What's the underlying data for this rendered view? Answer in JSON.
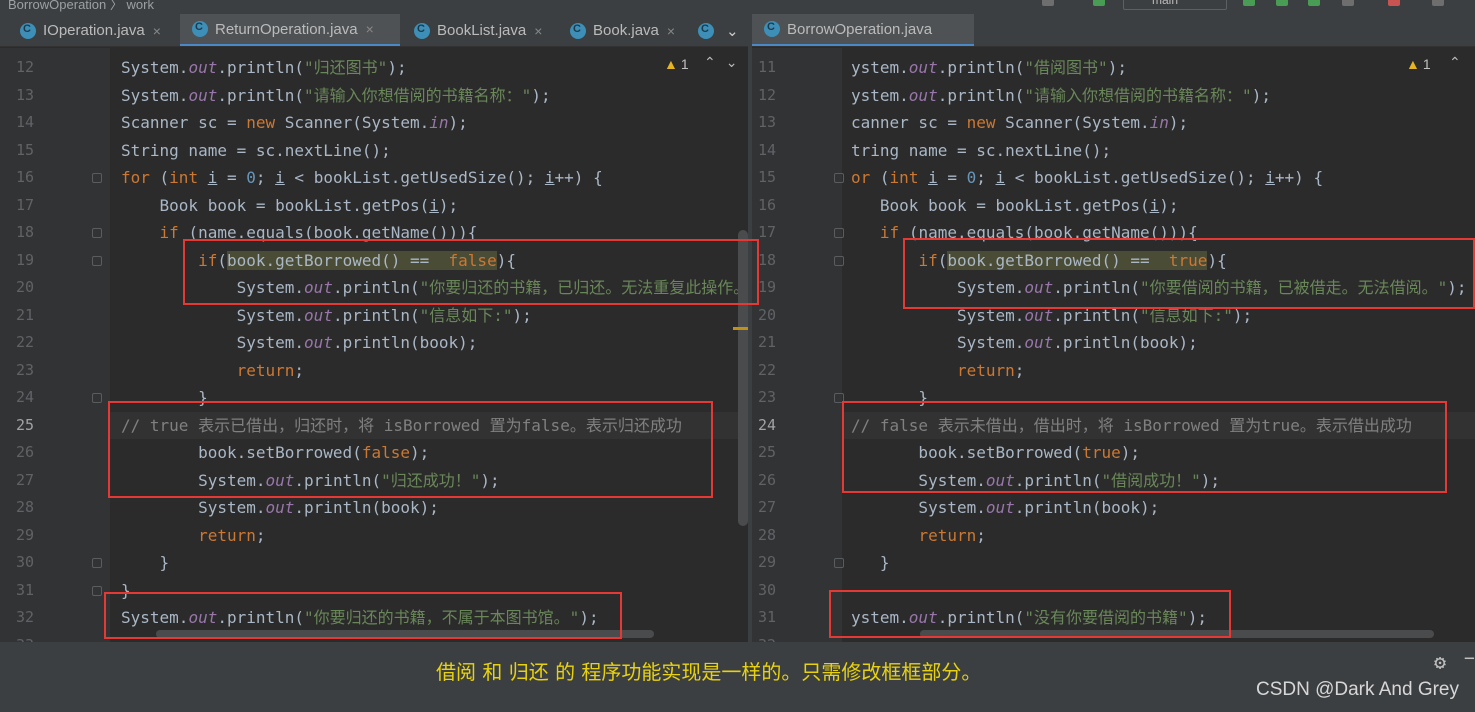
{
  "topbar": {
    "breadcrumb": "BorrowOperation  〉 work",
    "branch": "main"
  },
  "left_tabs": [
    {
      "label": "IOperation.java",
      "active": false
    },
    {
      "label": "ReturnOperation.java",
      "active": true
    },
    {
      "label": "BookList.java",
      "active": false
    },
    {
      "label": "Book.java",
      "active": false
    }
  ],
  "right_tabs": [
    {
      "label": "BorrowOperation.java",
      "active": true
    }
  ],
  "left_editor": {
    "warning_count": "1",
    "lines": [
      {
        "n": "12",
        "tokens": [
          [
            "p",
            "System."
          ],
          [
            "fld",
            "out"
          ],
          [
            "p",
            ".println("
          ],
          [
            "str",
            "\"归还图书\""
          ],
          [
            "p",
            ");"
          ]
        ]
      },
      {
        "n": "13",
        "tokens": [
          [
            "p",
            "System."
          ],
          [
            "fld",
            "out"
          ],
          [
            "p",
            ".println("
          ],
          [
            "str",
            "\"请输入你想借阅的书籍名称：\""
          ],
          [
            "p",
            ");"
          ]
        ]
      },
      {
        "n": "14",
        "tokens": [
          [
            "p",
            "Scanner sc = "
          ],
          [
            "kw",
            "new "
          ],
          [
            "p",
            "Scanner(System."
          ],
          [
            "fld",
            "in"
          ],
          [
            "p",
            ");"
          ]
        ]
      },
      {
        "n": "15",
        "tokens": [
          [
            "p",
            "String name = sc.nextLine();"
          ]
        ]
      },
      {
        "n": "16",
        "tokens": [
          [
            "kw",
            "for "
          ],
          [
            "p",
            "("
          ],
          [
            "kw",
            "int "
          ],
          [
            "u",
            "i"
          ],
          [
            "p",
            " = "
          ],
          [
            "num",
            "0"
          ],
          [
            "p",
            "; "
          ],
          [
            "u",
            "i"
          ],
          [
            "p",
            " < bookList.getUsedSize(); "
          ],
          [
            "u",
            "i"
          ],
          [
            "p",
            "++) {"
          ]
        ]
      },
      {
        "n": "17",
        "tokens": [
          [
            "p",
            "    Book book = bookList.getPos("
          ],
          [
            "u",
            "i"
          ],
          [
            "p",
            ");"
          ]
        ]
      },
      {
        "n": "18",
        "tokens": [
          [
            "p",
            "    "
          ],
          [
            "kw",
            "if "
          ],
          [
            "p",
            "(name.equals(book.getName())){"
          ]
        ]
      },
      {
        "n": "19",
        "tokens": [
          [
            "p",
            "        "
          ],
          [
            "kw",
            "if"
          ],
          [
            "p",
            "("
          ],
          [
            "hl",
            "book.getBorrowed() ==  "
          ],
          [
            "hlkw",
            "false"
          ],
          [
            "p",
            "){"
          ]
        ]
      },
      {
        "n": "20",
        "tokens": [
          [
            "p",
            "            System."
          ],
          [
            "fld",
            "out"
          ],
          [
            "p",
            ".println("
          ],
          [
            "str",
            "\"你要归还的书籍，已归还。无法重复此操作。\""
          ],
          [
            "p",
            ");"
          ]
        ]
      },
      {
        "n": "21",
        "tokens": [
          [
            "p",
            "            System."
          ],
          [
            "fld",
            "out"
          ],
          [
            "p",
            ".println("
          ],
          [
            "str",
            "\"信息如下:\""
          ],
          [
            "p",
            ");"
          ]
        ]
      },
      {
        "n": "22",
        "tokens": [
          [
            "p",
            "            System."
          ],
          [
            "fld",
            "out"
          ],
          [
            "p",
            ".println(book);"
          ]
        ]
      },
      {
        "n": "23",
        "tokens": [
          [
            "p",
            "            "
          ],
          [
            "kw",
            "return"
          ],
          [
            "p",
            ";"
          ]
        ]
      },
      {
        "n": "24",
        "tokens": [
          [
            "p",
            "        }"
          ]
        ]
      },
      {
        "n": "25",
        "tokens": [
          [
            "cmt",
            "// true 表示已借出，归还时，将 isBorrowed 置为false。表示归还成功"
          ]
        ]
      },
      {
        "n": "26",
        "tokens": [
          [
            "p",
            "        book.setBorrowed("
          ],
          [
            "kw",
            "false"
          ],
          [
            "p",
            ");"
          ]
        ]
      },
      {
        "n": "27",
        "tokens": [
          [
            "p",
            "        System."
          ],
          [
            "fld",
            "out"
          ],
          [
            "p",
            ".println("
          ],
          [
            "str",
            "\"归还成功！\""
          ],
          [
            "p",
            ");"
          ]
        ]
      },
      {
        "n": "28",
        "tokens": [
          [
            "p",
            "        System."
          ],
          [
            "fld",
            "out"
          ],
          [
            "p",
            ".println(book);"
          ]
        ]
      },
      {
        "n": "29",
        "tokens": [
          [
            "p",
            "        "
          ],
          [
            "kw",
            "return"
          ],
          [
            "p",
            ";"
          ]
        ]
      },
      {
        "n": "30",
        "tokens": [
          [
            "p",
            "    }"
          ]
        ]
      },
      {
        "n": "31",
        "tokens": [
          [
            "p",
            "}"
          ]
        ]
      },
      {
        "n": "32",
        "tokens": [
          [
            "p",
            "System."
          ],
          [
            "fld",
            "out"
          ],
          [
            "p",
            ".println("
          ],
          [
            "str",
            "\"你要归还的书籍，不属于本图书馆。\""
          ],
          [
            "p",
            ");"
          ]
        ]
      },
      {
        "n": "33",
        "tokens": []
      }
    ]
  },
  "right_editor": {
    "warning_count": "1",
    "lines": [
      {
        "n": "11",
        "tokens": [
          [
            "p",
            "ystem."
          ],
          [
            "fld",
            "out"
          ],
          [
            "p",
            ".println("
          ],
          [
            "str",
            "\"借阅图书\""
          ],
          [
            "p",
            ");"
          ]
        ]
      },
      {
        "n": "12",
        "tokens": [
          [
            "p",
            "ystem."
          ],
          [
            "fld",
            "out"
          ],
          [
            "p",
            ".println("
          ],
          [
            "str",
            "\"请输入你想借阅的书籍名称：\""
          ],
          [
            "p",
            ");"
          ]
        ]
      },
      {
        "n": "13",
        "tokens": [
          [
            "p",
            "canner sc = "
          ],
          [
            "kw",
            "new "
          ],
          [
            "p",
            "Scanner(System."
          ],
          [
            "fld",
            "in"
          ],
          [
            "p",
            ");"
          ]
        ]
      },
      {
        "n": "14",
        "tokens": [
          [
            "p",
            "tring name = sc.nextLine();"
          ]
        ]
      },
      {
        "n": "15",
        "tokens": [
          [
            "kw",
            "or "
          ],
          [
            "p",
            "("
          ],
          [
            "kw",
            "int "
          ],
          [
            "u",
            "i"
          ],
          [
            "p",
            " = "
          ],
          [
            "num",
            "0"
          ],
          [
            "p",
            "; "
          ],
          [
            "u",
            "i"
          ],
          [
            "p",
            " < bookList.getUsedSize(); "
          ],
          [
            "u",
            "i"
          ],
          [
            "p",
            "++) {"
          ]
        ]
      },
      {
        "n": "16",
        "tokens": [
          [
            "p",
            "   Book book = bookList.getPos("
          ],
          [
            "u",
            "i"
          ],
          [
            "p",
            ");"
          ]
        ]
      },
      {
        "n": "17",
        "tokens": [
          [
            "p",
            "   "
          ],
          [
            "kw",
            "if "
          ],
          [
            "p",
            "(name.equals(book.getName())){"
          ]
        ]
      },
      {
        "n": "18",
        "tokens": [
          [
            "p",
            "       "
          ],
          [
            "kw",
            "if"
          ],
          [
            "p",
            "("
          ],
          [
            "hl",
            "book.getBorrowed() ==  "
          ],
          [
            "hlkw",
            "true"
          ],
          [
            "p",
            "){"
          ]
        ]
      },
      {
        "n": "19",
        "tokens": [
          [
            "p",
            "           System."
          ],
          [
            "fld",
            "out"
          ],
          [
            "p",
            ".println("
          ],
          [
            "str",
            "\"你要借阅的书籍，已被借走。无法借阅。\""
          ],
          [
            "p",
            ");"
          ]
        ]
      },
      {
        "n": "20",
        "tokens": [
          [
            "p",
            "           System."
          ],
          [
            "fld",
            "out"
          ],
          [
            "p",
            ".println("
          ],
          [
            "str",
            "\"信息如下:\""
          ],
          [
            "p",
            ");"
          ]
        ]
      },
      {
        "n": "21",
        "tokens": [
          [
            "p",
            "           System."
          ],
          [
            "fld",
            "out"
          ],
          [
            "p",
            ".println(book);"
          ]
        ]
      },
      {
        "n": "22",
        "tokens": [
          [
            "p",
            "           "
          ],
          [
            "kw",
            "return"
          ],
          [
            "p",
            ";"
          ]
        ]
      },
      {
        "n": "23",
        "tokens": [
          [
            "p",
            "       }"
          ]
        ]
      },
      {
        "n": "24",
        "tokens": [
          [
            "cmt",
            "// false 表示未借出，借出时，将 isBorrowed 置为true。表示借出成功"
          ]
        ]
      },
      {
        "n": "25",
        "tokens": [
          [
            "p",
            "       book.setBorrowed("
          ],
          [
            "kw",
            "true"
          ],
          [
            "p",
            ");"
          ]
        ]
      },
      {
        "n": "26",
        "tokens": [
          [
            "p",
            "       System."
          ],
          [
            "fld",
            "out"
          ],
          [
            "p",
            ".println("
          ],
          [
            "str",
            "\"借阅成功！\""
          ],
          [
            "p",
            ");"
          ]
        ]
      },
      {
        "n": "27",
        "tokens": [
          [
            "p",
            "       System."
          ],
          [
            "fld",
            "out"
          ],
          [
            "p",
            ".println(book);"
          ]
        ]
      },
      {
        "n": "28",
        "tokens": [
          [
            "p",
            "       "
          ],
          [
            "kw",
            "return"
          ],
          [
            "p",
            ";"
          ]
        ]
      },
      {
        "n": "29",
        "tokens": [
          [
            "p",
            "   }"
          ]
        ]
      },
      {
        "n": "30",
        "tokens": []
      },
      {
        "n": "31",
        "tokens": [
          [
            "p",
            "ystem."
          ],
          [
            "fld",
            "out"
          ],
          [
            "p",
            ".println("
          ],
          [
            "str",
            "\"没有你要借阅的书籍\""
          ],
          [
            "p",
            ");"
          ]
        ]
      },
      {
        "n": "32",
        "tokens": []
      }
    ]
  },
  "caption": "借阅 和 归还 的 程序功能实现是一样的。只需修改框框部分。",
  "watermark": "CSDN @Dark And Grey",
  "colors": {
    "keyword": "#cc7832",
    "string": "#6a8759",
    "field": "#9876aa",
    "number": "#6897bb",
    "comment": "#808080",
    "annotation_box": "#e53935",
    "caption": "#e8d20d"
  }
}
